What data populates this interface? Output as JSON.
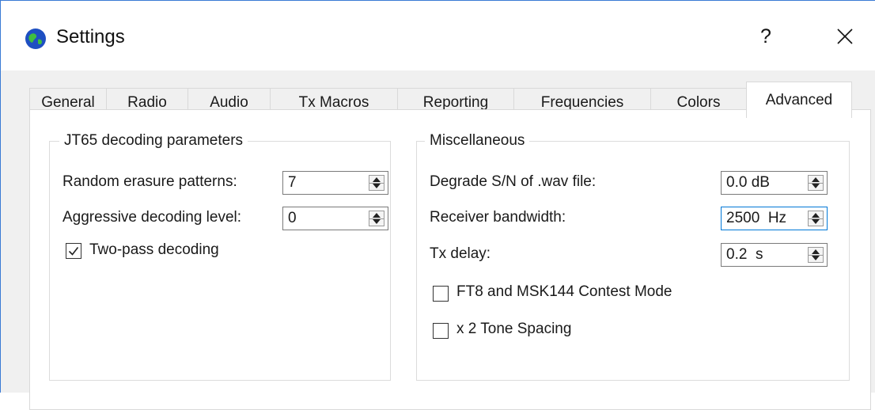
{
  "window": {
    "title": "Settings",
    "help_label": "?",
    "icon": "app-globe-icon",
    "accent": "#0078d7"
  },
  "tabs": [
    {
      "label": "General",
      "active": false
    },
    {
      "label": "Radio",
      "active": false
    },
    {
      "label": "Audio",
      "active": false
    },
    {
      "label": "Tx Macros",
      "active": false
    },
    {
      "label": "Reporting",
      "active": false
    },
    {
      "label": "Frequencies",
      "active": false
    },
    {
      "label": "Colors",
      "active": false
    },
    {
      "label": "Advanced",
      "active": true
    }
  ],
  "jt65": {
    "title": "JT65 decoding parameters",
    "random_erasure_label": "Random erasure patterns:",
    "random_erasure_value": "7",
    "aggressive_label": "Aggressive decoding level:",
    "aggressive_value": "0",
    "two_pass_label": "Two-pass decoding",
    "two_pass_checked": true
  },
  "misc": {
    "title": "Miscellaneous",
    "degrade_label": "Degrade S/N of .wav file:",
    "degrade_value": "0.0 dB",
    "bandwidth_label": "Receiver bandwidth:",
    "bandwidth_value": "2500  Hz",
    "txdelay_label": "Tx delay:",
    "txdelay_value": "0.2  s",
    "contest_label": "FT8 and MSK144 Contest Mode",
    "contest_checked": false,
    "tone_label": "x 2 Tone Spacing",
    "tone_checked": false
  }
}
